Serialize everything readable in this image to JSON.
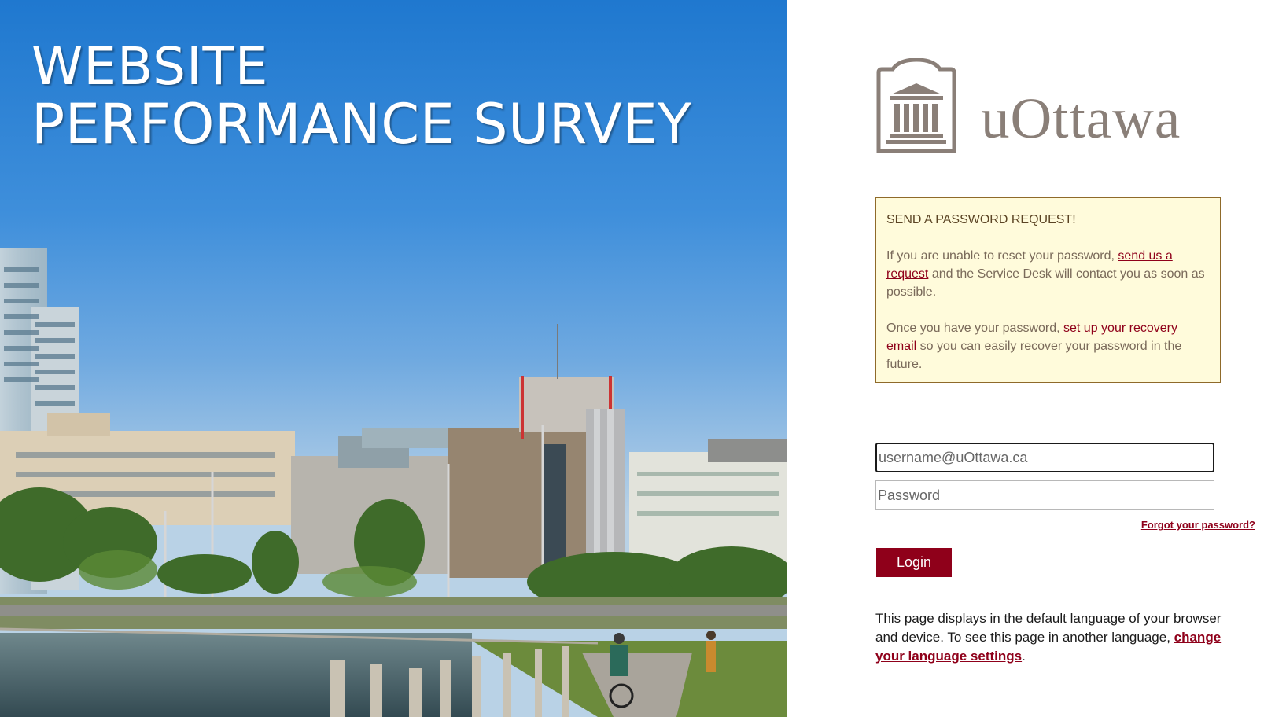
{
  "hero": {
    "title_line1": "WEBSITE",
    "title_line2": "PERFORMANCE SURVEY"
  },
  "logo": {
    "wordmark": "uOttawa",
    "icon": "university-building-icon"
  },
  "notice": {
    "title": "SEND A PASSWORD REQUEST!",
    "p1_before": "If you are unable to reset your password, ",
    "p1_link": "send us a request",
    "p1_after": " and the Service Desk will contact you as soon as possible.",
    "p2_before": "Once you have your password, ",
    "p2_link": "set up your recovery email",
    "p2_after": " so you can easily recover your password in the future."
  },
  "form": {
    "username_placeholder": "username@uOttawa.ca",
    "password_placeholder": "Password",
    "forgot_label": "Forgot your password?",
    "login_label": "Login"
  },
  "language": {
    "text_before": "This page displays in the default language of your browser and device. To see this page in another language, ",
    "link": "change your language settings",
    "text_after": "."
  },
  "colors": {
    "brand": "#8f001a",
    "notice_bg": "#fffbdb",
    "notice_border": "#8f6a2a",
    "logo_grey": "#8a7f78"
  }
}
